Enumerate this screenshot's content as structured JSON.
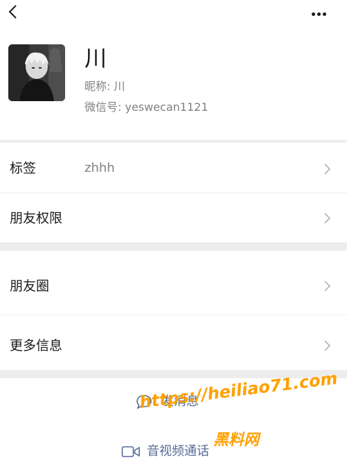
{
  "profile": {
    "display_name": "川",
    "nickname": "昵称: 川",
    "wechat_id": "微信号: yeswecan1121"
  },
  "rows": {
    "tag_label": "标签",
    "tag_value": "zhhh",
    "permissions_label": "朋友权限",
    "moments_label": "朋友圈",
    "more_info_label": "更多信息"
  },
  "actions": {
    "send_message": "发消息",
    "av_call": "音视频通话"
  },
  "watermark": {
    "url": "https://heiliao71.com",
    "name": "黑料网"
  },
  "icons": [
    "back-icon",
    "more-icon",
    "chevron-right-icon",
    "chat-bubble-icon",
    "video-call-icon"
  ],
  "colors": {
    "accent": "#576b95",
    "background": "#ededed",
    "watermark": "#ffa000"
  }
}
